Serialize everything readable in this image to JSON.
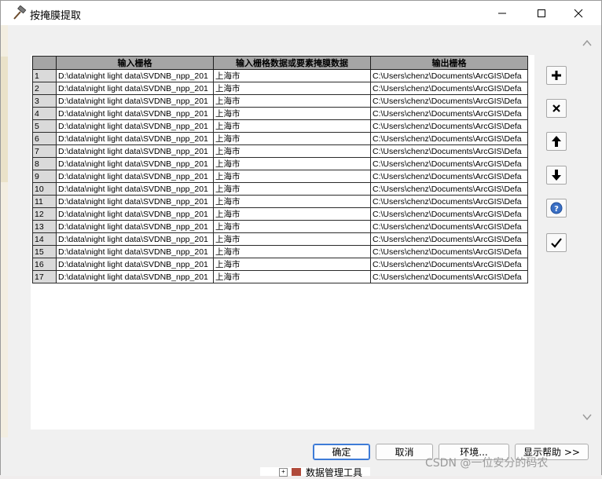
{
  "window": {
    "title": "按掩膜提取"
  },
  "table": {
    "headers": [
      "输入栅格",
      "输入栅格数据或要素掩膜数据",
      "输出栅格"
    ],
    "rows": [
      {
        "num": "1",
        "input": "D:\\data\\night light data\\SVDNB_npp_201",
        "mask": "上海市",
        "output": "C:\\Users\\chenz\\Documents\\ArcGIS\\Defa"
      },
      {
        "num": "2",
        "input": "D:\\data\\night light data\\SVDNB_npp_201",
        "mask": "上海市",
        "output": "C:\\Users\\chenz\\Documents\\ArcGIS\\Defa"
      },
      {
        "num": "3",
        "input": "D:\\data\\night light data\\SVDNB_npp_201",
        "mask": "上海市",
        "output": "C:\\Users\\chenz\\Documents\\ArcGIS\\Defa"
      },
      {
        "num": "4",
        "input": "D:\\data\\night light data\\SVDNB_npp_201",
        "mask": "上海市",
        "output": "C:\\Users\\chenz\\Documents\\ArcGIS\\Defa"
      },
      {
        "num": "5",
        "input": "D:\\data\\night light data\\SVDNB_npp_201",
        "mask": "上海市",
        "output": "C:\\Users\\chenz\\Documents\\ArcGIS\\Defa"
      },
      {
        "num": "6",
        "input": "D:\\data\\night light data\\SVDNB_npp_201",
        "mask": "上海市",
        "output": "C:\\Users\\chenz\\Documents\\ArcGIS\\Defa"
      },
      {
        "num": "7",
        "input": "D:\\data\\night light data\\SVDNB_npp_201",
        "mask": "上海市",
        "output": "C:\\Users\\chenz\\Documents\\ArcGIS\\Defa"
      },
      {
        "num": "8",
        "input": "D:\\data\\night light data\\SVDNB_npp_201",
        "mask": "上海市",
        "output": "C:\\Users\\chenz\\Documents\\ArcGIS\\Defa"
      },
      {
        "num": "9",
        "input": "D:\\data\\night light data\\SVDNB_npp_201",
        "mask": "上海市",
        "output": "C:\\Users\\chenz\\Documents\\ArcGIS\\Defa"
      },
      {
        "num": "10",
        "input": "D:\\data\\night light data\\SVDNB_npp_201",
        "mask": "上海市",
        "output": "C:\\Users\\chenz\\Documents\\ArcGIS\\Defa"
      },
      {
        "num": "11",
        "input": "D:\\data\\night light data\\SVDNB_npp_201",
        "mask": "上海市",
        "output": "C:\\Users\\chenz\\Documents\\ArcGIS\\Defa"
      },
      {
        "num": "12",
        "input": "D:\\data\\night light data\\SVDNB_npp_201",
        "mask": "上海市",
        "output": "C:\\Users\\chenz\\Documents\\ArcGIS\\Defa"
      },
      {
        "num": "13",
        "input": "D:\\data\\night light data\\SVDNB_npp_201",
        "mask": "上海市",
        "output": "C:\\Users\\chenz\\Documents\\ArcGIS\\Defa"
      },
      {
        "num": "14",
        "input": "D:\\data\\night light data\\SVDNB_npp_201",
        "mask": "上海市",
        "output": "C:\\Users\\chenz\\Documents\\ArcGIS\\Defa"
      },
      {
        "num": "15",
        "input": "D:\\data\\night light data\\SVDNB_npp_201",
        "mask": "上海市",
        "output": "C:\\Users\\chenz\\Documents\\ArcGIS\\Defa"
      },
      {
        "num": "16",
        "input": "D:\\data\\night light data\\SVDNB_npp_201",
        "mask": "上海市",
        "output": "C:\\Users\\chenz\\Documents\\ArcGIS\\Defa"
      },
      {
        "num": "17",
        "input": "D:\\data\\night light data\\SVDNB_npp_201",
        "mask": "上海市",
        "output": "C:\\Users\\chenz\\Documents\\ArcGIS\\Defa"
      }
    ]
  },
  "side_buttons": [
    "plus-icon",
    "close-x-icon",
    "arrow-up-icon",
    "arrow-down-icon",
    "help-icon",
    "checkmark-icon"
  ],
  "footer": {
    "ok_label": "确定",
    "cancel_label": "取消",
    "env_label": "环境...",
    "help_label": "显示帮助 >>"
  },
  "background": {
    "tree_item": "数据管理工具"
  },
  "watermark": "CSDN @一位安分的码农",
  "colors": {
    "header_bg": "#a5a5a5",
    "rownum_bg": "#dadada",
    "help_blue": "#3a6fc4",
    "focus_border": "#3d7bd7"
  }
}
